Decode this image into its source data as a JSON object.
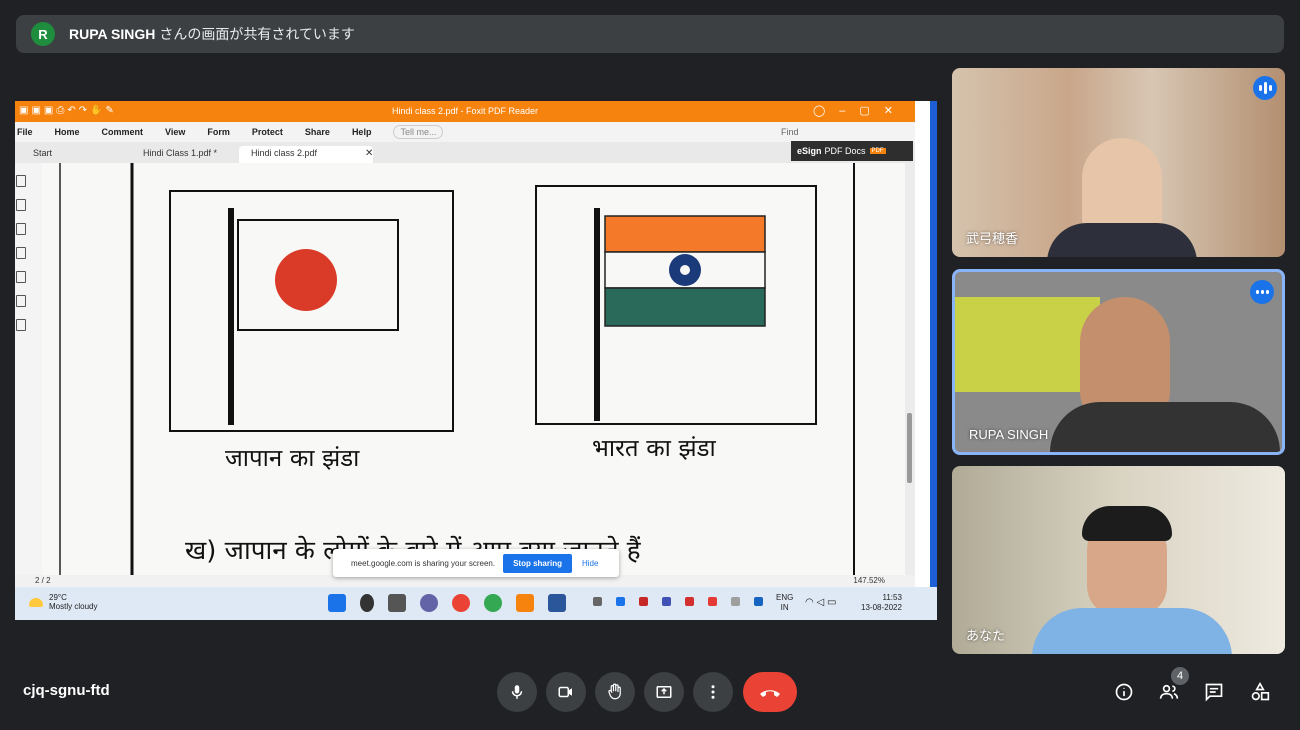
{
  "banner": {
    "avatar_letter": "R",
    "presenter": "RUPA SINGH",
    "message": "さんの画面が共有されています"
  },
  "pdf_window": {
    "title": "Hindi class 2.pdf - Foxit PDF Reader",
    "menus": [
      "File",
      "Home",
      "Comment",
      "View",
      "Form",
      "Protect",
      "Share",
      "Help"
    ],
    "tell_placeholder": "Tell me...",
    "find_placeholder": "Find",
    "tabs": [
      "Start",
      "Hindi Class 1.pdf *",
      "Hindi class 2.pdf"
    ],
    "esign": {
      "bold": "eSign",
      "text": "PDF Docs",
      "tag": "PDF"
    },
    "page": {
      "caption_japan": "जापान का झंडा",
      "caption_india": "भारत का झंडा",
      "question": "ख) जापान के लोगों के बारे में आप क्या जानते हैं"
    },
    "status": {
      "page_indicator": "2 / 2",
      "zoom": "147.52%"
    }
  },
  "share_popup": {
    "message": "meet.google.com is sharing your screen.",
    "stop": "Stop sharing",
    "hide": "Hide"
  },
  "taskbar": {
    "weather_temp": "29°C",
    "weather_desc": "Mostly cloudy",
    "lang_1": "ENG",
    "lang_2": "IN",
    "time": "11:53",
    "date": "13-08-2022"
  },
  "participants": [
    {
      "name": "武弓穂香",
      "speaking": true
    },
    {
      "name": "RUPA SINGH",
      "speaking": true
    },
    {
      "name": "あなた",
      "speaking": false
    }
  ],
  "meeting_code": "cjq-sgnu-ftd",
  "people_count": "4",
  "colors": {
    "accent": "#1a73e8",
    "end_call": "#ea4335",
    "foxit": "#f7830f"
  }
}
